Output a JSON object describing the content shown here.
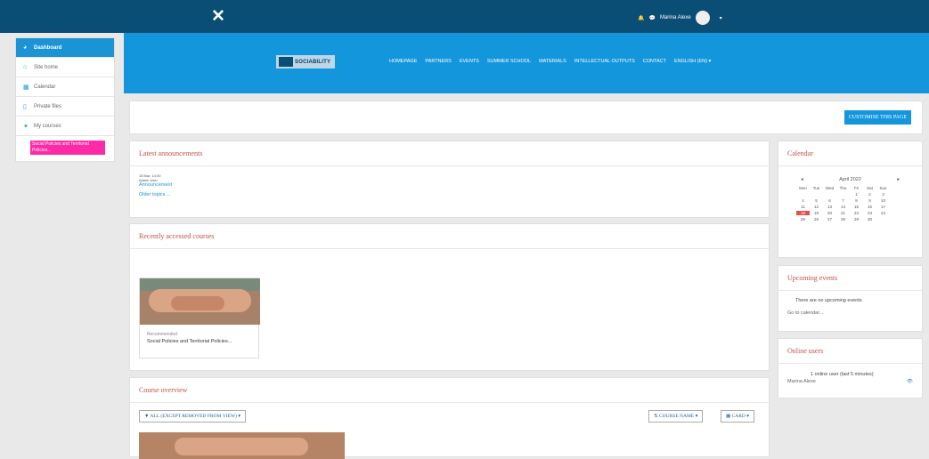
{
  "topbar": {
    "close_glyph": "✕",
    "bell_glyph": "🔔",
    "chat_glyph": "💬",
    "user_name": "Marina Alexe",
    "caret": "▾"
  },
  "sidebar": {
    "items": [
      {
        "label": "Dashboard",
        "icon": "tachometer-icon",
        "glyph": "◕"
      },
      {
        "label": "Site home",
        "icon": "home-icon",
        "glyph": "⌂"
      },
      {
        "label": "Calendar",
        "icon": "calendar-icon",
        "glyph": "▦"
      },
      {
        "label": "Private files",
        "icon": "file-icon",
        "glyph": "▯"
      },
      {
        "label": "My courses",
        "icon": "graduation-cap-icon",
        "glyph": "✦"
      }
    ],
    "highlighted_course": "Social Policies and Territorial Policies..."
  },
  "header": {
    "logo_text": "SOCIABILITY",
    "nav": [
      "HOMEPAGE",
      "PARTNERS",
      "EVENTS",
      "SUMMER SCHOOL",
      "MATERIALS",
      "INTELLECTUAL OUTPUTS",
      "CONTACT",
      "ENGLISH (EN) ▾"
    ]
  },
  "customise_button": "CUSTOMISE THIS PAGE",
  "announcements": {
    "title": "Latest announcements",
    "date": "15 Mar, 14:00",
    "author": "Admin User",
    "post_link": "Announcement",
    "older_link": "Older topics ..."
  },
  "recent_courses": {
    "title": "Recently accessed courses",
    "card_category": "Recommended",
    "card_name": "Social Policies and Territorial Policies..."
  },
  "course_overview": {
    "title": "Course overview",
    "filter_label": "▼ ALL (EXCEPT REMOVED FROM VIEW) ▾",
    "sort_label": "⇅ COURSE NAME ▾",
    "view_label": "▦ CARD ▾"
  },
  "calendar": {
    "title": "Calendar",
    "prev": "◂",
    "next": "▸",
    "month": "April 2022",
    "weekdays": [
      "Mon",
      "Tue",
      "Wed",
      "Thu",
      "Fri",
      "Sat",
      "Sun"
    ],
    "days": [
      "",
      "",
      "",
      "",
      "1",
      "2",
      "3",
      "4",
      "5",
      "6",
      "7",
      "8",
      "9",
      "10",
      "11",
      "12",
      "13",
      "14",
      "15",
      "16",
      "17",
      "18",
      "19",
      "20",
      "21",
      "22",
      "23",
      "24",
      "25",
      "26",
      "27",
      "28",
      "29",
      "30"
    ],
    "today": "18"
  },
  "upcoming": {
    "title": "Upcoming events",
    "empty_text": "There are no upcoming events",
    "link": "Go to calendar..."
  },
  "online": {
    "title": "Online users",
    "summary": "1 online user (last 5 minutes)",
    "user": "Marina Alexe",
    "eye_glyph": "👁"
  }
}
